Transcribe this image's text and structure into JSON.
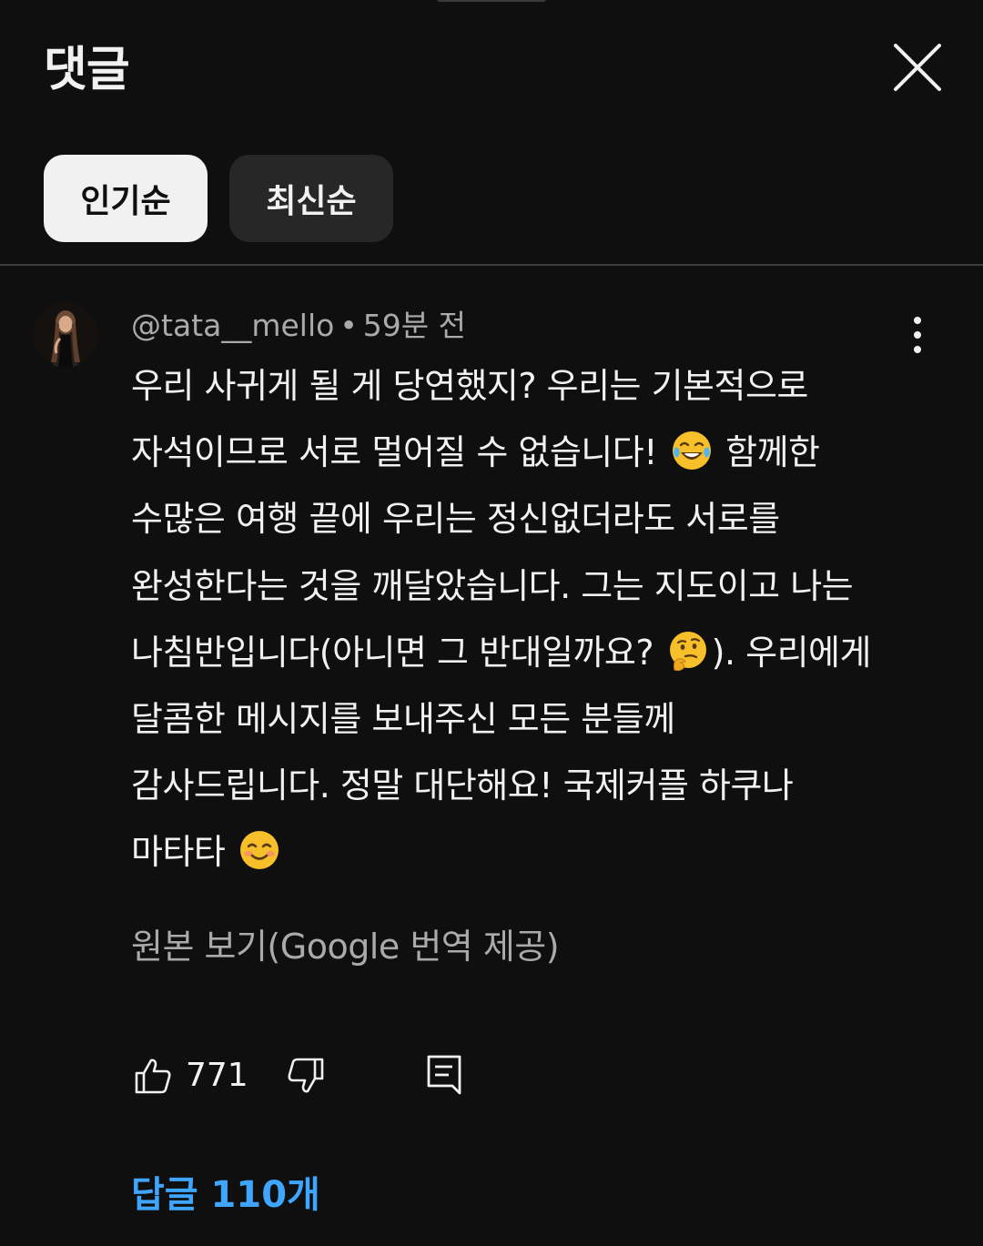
{
  "header": {
    "title": "댓글",
    "close_icon": "close-icon"
  },
  "sort_chips": [
    {
      "label": "인기순",
      "selected": true
    },
    {
      "label": "최신순",
      "selected": false
    }
  ],
  "comment": {
    "author": "@tata__mello",
    "separator": "•",
    "time": "59분 전",
    "lines": [
      [
        "우리 사귀게 될 게 당연했지? 우리는 기본적으로"
      ],
      [
        "자석이므로 서로 멀어질 수 없습니다! ",
        "😂",
        " 함께한"
      ],
      [
        "수많은 여행 끝에 우리는 정신없더라도 서로를"
      ],
      [
        "완성한다는 것을 깨달았습니다. 그는 지도이고 나는"
      ],
      [
        "나침반입니다(아니면 그 반대일까요? ",
        "🤔",
        "). 우리에게"
      ],
      [
        "달콤한 메시지를 보내주신 모든 분들께"
      ],
      [
        "감사드립니다. 정말 대단해요! 국제커플 하쿠나"
      ],
      [
        "마타타 ",
        "😊"
      ]
    ],
    "translate_label": "원본 보기(Google 번역 제공)",
    "like_count": "771",
    "replies_label": "답글 110개"
  },
  "colors": {
    "background": "#0f0f0f",
    "text_primary": "#f1f1f1",
    "text_secondary": "#aaaaaa",
    "link_blue": "#3ea6ff",
    "chip_selected_bg": "#f1f1f1",
    "chip_bg": "#272727"
  }
}
